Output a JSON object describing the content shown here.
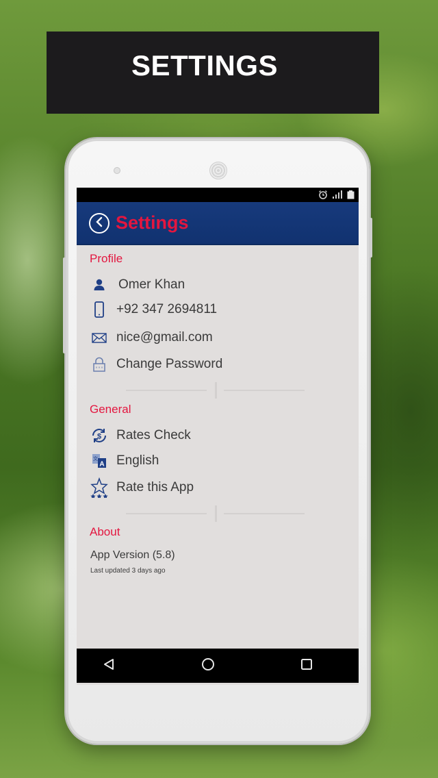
{
  "banner": {
    "title": "SETTINGS"
  },
  "app": {
    "title": "Settings",
    "colors": {
      "header_bg": "#173a7c",
      "accent": "#e3163f",
      "screen_bg": "#e1dedd",
      "icon": "#1f3f86"
    }
  },
  "status_bar": {
    "icons": [
      "alarm-icon",
      "signal-icon",
      "battery-icon"
    ]
  },
  "sections": {
    "profile": {
      "label": "Profile",
      "items": [
        {
          "icon": "person-icon",
          "text": "Omer Khan"
        },
        {
          "icon": "phone-icon",
          "text": "+92 347 2694811"
        },
        {
          "icon": "mail-icon",
          "text": "nice@gmail.com"
        },
        {
          "icon": "lock-icon",
          "text": "Change Password"
        }
      ]
    },
    "general": {
      "label": "General",
      "items": [
        {
          "icon": "currency-exchange-icon",
          "text": "Rates Check"
        },
        {
          "icon": "translate-icon",
          "text": "English"
        },
        {
          "icon": "star-rating-icon",
          "text": "Rate this App"
        }
      ]
    },
    "about": {
      "label": "About",
      "version": "App Version (5.8)",
      "updated": "Last updated 3 days ago"
    }
  },
  "nav_bar": {
    "items": [
      "back-triangle-icon",
      "home-circle-icon",
      "recents-square-icon"
    ]
  }
}
